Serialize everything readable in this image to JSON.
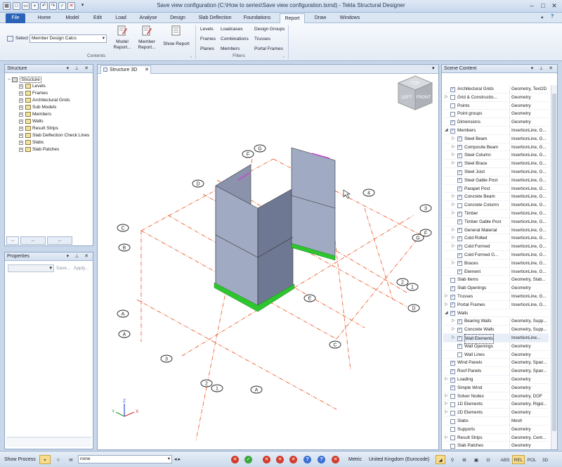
{
  "window": {
    "title": "Save view configuration (C:\\How to series\\Save view configuration.tsmd) - Tekla Structural Designer"
  },
  "ribbon_tabs": [
    "File",
    "Home",
    "Model",
    "Edit",
    "Load",
    "Analyse",
    "Design",
    "Slab Deflection",
    "Foundations",
    "Report",
    "Draw",
    "Windows"
  ],
  "ribbon": {
    "select_label": "Select",
    "select_value": "Member Design Calcs",
    "model_report": "Model\nReport...",
    "member_report": "Member\nReport...",
    "show_report": "Show Report",
    "contents_label": "Contents",
    "filters_label": "Filters",
    "filters": [
      [
        "Levels",
        "Loadcases",
        "Design Groups"
      ],
      [
        "Frames",
        "Combinations",
        "Trusses"
      ],
      [
        "Planes",
        "Members",
        "Portal Frames"
      ]
    ]
  },
  "structure_panel": {
    "title": "Structure",
    "root": "Structure",
    "items": [
      "Levels",
      "Frames",
      "Architectural Grids",
      "Sub Models",
      "Members",
      "Walls",
      "Result Strips",
      "Slab Deflection Check Lines",
      "Slabs",
      "Slab Patches"
    ],
    "bottom_tabs": [
      "...",
      "...",
      "..."
    ]
  },
  "properties_panel": {
    "title": "Properties",
    "save_label": "Save...",
    "apply_label": "Apply..."
  },
  "view": {
    "tab_label": "Structure 3D",
    "cube_labels": [
      "TOP",
      "LEFT",
      "FRONT"
    ],
    "axis_labels": [
      "X",
      "Y",
      "Z"
    ],
    "grid_labels_left": [
      "C",
      "B",
      "A",
      "A"
    ],
    "grid_labels_bottom": [
      "3",
      "2",
      "1",
      "A"
    ],
    "grid_labels_top": [
      "F",
      "G",
      "D"
    ],
    "grid_labels_right": [
      "4",
      "3",
      "F",
      "G",
      "2",
      "1",
      "D",
      "E",
      "C",
      "B"
    ]
  },
  "scene_panel": {
    "title": "Scene Content",
    "rows": [
      {
        "name": "Architectural Grids",
        "type": "Geometry, Text2D",
        "indent": 0,
        "checked": true,
        "arrow": ""
      },
      {
        "name": "Grid & Constructio...",
        "type": "Geometry",
        "indent": 0,
        "checked": false,
        "arrow": "▷"
      },
      {
        "name": "Points",
        "type": "Geometry",
        "indent": 0,
        "checked": false,
        "arrow": ""
      },
      {
        "name": "Point groups",
        "type": "Geometry",
        "indent": 0,
        "checked": false,
        "arrow": ""
      },
      {
        "name": "Dimensions",
        "type": "Geometry",
        "indent": 0,
        "checked": true,
        "arrow": ""
      },
      {
        "name": "Members",
        "type": "InsertionLine, G...",
        "indent": 0,
        "checked": true,
        "arrow": "◢"
      },
      {
        "name": "Steel Beam",
        "type": "InsertionLine, G...",
        "indent": 1,
        "checked": true,
        "arrow": "▷"
      },
      {
        "name": "Composite Beam",
        "type": "InsertionLine, G...",
        "indent": 1,
        "checked": true,
        "arrow": "▷"
      },
      {
        "name": "Steel Column",
        "type": "InsertionLine, G...",
        "indent": 1,
        "checked": true,
        "arrow": "▷"
      },
      {
        "name": "Steel Brace",
        "type": "InsertionLine, G...",
        "indent": 1,
        "checked": true,
        "arrow": "▷"
      },
      {
        "name": "Steel Joist",
        "type": "InsertionLine, G...",
        "indent": 1,
        "checked": true,
        "arrow": ""
      },
      {
        "name": "Steel Gable Post",
        "type": "InsertionLine, G...",
        "indent": 1,
        "checked": true,
        "arrow": ""
      },
      {
        "name": "Parapet Post",
        "type": "InsertionLine, G...",
        "indent": 1,
        "checked": true,
        "arrow": ""
      },
      {
        "name": "Concrete Beam",
        "type": "InsertionLine, G...",
        "indent": 1,
        "checked": true,
        "arrow": "▷"
      },
      {
        "name": "Concrete Column",
        "type": "InsertionLine, G...",
        "indent": 1,
        "checked": false,
        "arrow": "▷"
      },
      {
        "name": "Timber",
        "type": "InsertionLine, G...",
        "indent": 1,
        "checked": true,
        "arrow": "▷"
      },
      {
        "name": "Timber Gable Post",
        "type": "InsertionLine, G...",
        "indent": 1,
        "checked": true,
        "arrow": ""
      },
      {
        "name": "General Material",
        "type": "InsertionLine, G...",
        "indent": 1,
        "checked": true,
        "arrow": "▷"
      },
      {
        "name": "Cold Rolled",
        "type": "InsertionLine, G...",
        "indent": 1,
        "checked": true,
        "arrow": "▷"
      },
      {
        "name": "Cold Formed",
        "type": "InsertionLine, G...",
        "indent": 1,
        "checked": true,
        "arrow": "▷"
      },
      {
        "name": "Cold Formed G...",
        "type": "InsertionLine, G...",
        "indent": 1,
        "checked": true,
        "arrow": ""
      },
      {
        "name": "Braces",
        "type": "InsertionLine, G...",
        "indent": 1,
        "checked": true,
        "arrow": "▷"
      },
      {
        "name": "Element",
        "type": "InsertionLine, G...",
        "indent": 1,
        "checked": true,
        "arrow": ""
      },
      {
        "name": "Slab Items",
        "type": "Geometry, Slab...",
        "indent": 0,
        "checked": false,
        "arrow": ""
      },
      {
        "name": "Slab Openings",
        "type": "Geometry",
        "indent": 0,
        "checked": true,
        "arrow": ""
      },
      {
        "name": "Trusses",
        "type": "InsertionLine, G...",
        "indent": 0,
        "checked": true,
        "arrow": "▷"
      },
      {
        "name": "Portal Frames",
        "type": "InsertionLine, G...",
        "indent": 0,
        "checked": true,
        "arrow": "▷"
      },
      {
        "name": "Walls",
        "type": "",
        "indent": 0,
        "checked": true,
        "arrow": "◢"
      },
      {
        "name": "Bearing Walls",
        "type": "Geometry, Supp...",
        "indent": 1,
        "checked": true,
        "arrow": "▷"
      },
      {
        "name": "Concrete Walls",
        "type": "Geometry, Supp...",
        "indent": 1,
        "checked": true,
        "arrow": "▷"
      },
      {
        "name": "Wall Elements",
        "type": "InsertionLine...",
        "indent": 1,
        "checked": true,
        "arrow": "▷",
        "selected": true
      },
      {
        "name": "Wall Openings",
        "type": "Geometry",
        "indent": 1,
        "checked": true,
        "arrow": ""
      },
      {
        "name": "Wall Lines",
        "type": "Geometry",
        "indent": 1,
        "checked": false,
        "arrow": ""
      },
      {
        "name": "Wind Panels",
        "type": "Geometry, Span...",
        "indent": 0,
        "checked": true,
        "arrow": ""
      },
      {
        "name": "Roof Panels",
        "type": "Geometry, Span...",
        "indent": 0,
        "checked": true,
        "arrow": ""
      },
      {
        "name": "Loading",
        "type": "Geometry",
        "indent": 0,
        "checked": true,
        "arrow": "▷"
      },
      {
        "name": "Simple Wind",
        "type": "Geometry",
        "indent": 0,
        "checked": true,
        "arrow": ""
      },
      {
        "name": "Solver Nodes",
        "type": "Geometry, DOF",
        "indent": 0,
        "checked": false,
        "arrow": "▷"
      },
      {
        "name": "1D Elements",
        "type": "Geometry, Rigid...",
        "indent": 0,
        "checked": false,
        "arrow": "▷"
      },
      {
        "name": "2D Elements",
        "type": "Geometry",
        "indent": 0,
        "checked": false,
        "arrow": "▷"
      },
      {
        "name": "Slabs",
        "type": "Mesh",
        "indent": 0,
        "checked": false,
        "arrow": ""
      },
      {
        "name": "Supports",
        "type": "Geometry",
        "indent": 0,
        "checked": false,
        "arrow": ""
      },
      {
        "name": "Result Strips",
        "type": "Geometry, Cent...",
        "indent": 0,
        "checked": false,
        "arrow": "▷"
      },
      {
        "name": "Slab Patches",
        "type": "Geometry",
        "indent": 0,
        "checked": false,
        "arrow": ""
      }
    ]
  },
  "statusbar": {
    "show_process": "Show Process",
    "filter_value": "none",
    "units": "Metric",
    "code": "United Kingdom (Eurocode)",
    "toggles": [
      "ABS",
      "REL",
      "POL",
      "3D"
    ]
  },
  "colors": {
    "accent": "#2a63b8",
    "wall": "#9aa4bd",
    "support": "#2ec62e",
    "grid": "#e8501e"
  }
}
